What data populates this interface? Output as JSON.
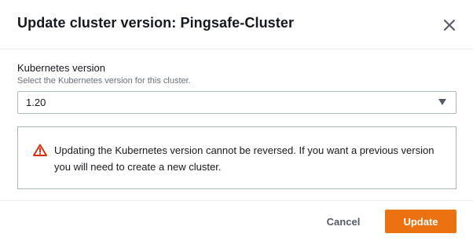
{
  "dialog": {
    "title": "Update cluster version: Pingsafe-Cluster",
    "close_icon": "close-icon"
  },
  "field": {
    "label": "Kubernetes version",
    "description": "Select the Kubernetes version for this cluster.",
    "selected_value": "1.20",
    "caret_icon": "caret-down-icon"
  },
  "alert": {
    "icon": "warning-icon",
    "message": "Updating the Kubernetes version cannot be reversed. If you want a previous version you will need to create a new cluster.",
    "icon_color": "#d13212"
  },
  "footer": {
    "cancel_label": "Cancel",
    "update_label": "Update",
    "accent_color": "#ec7211"
  }
}
